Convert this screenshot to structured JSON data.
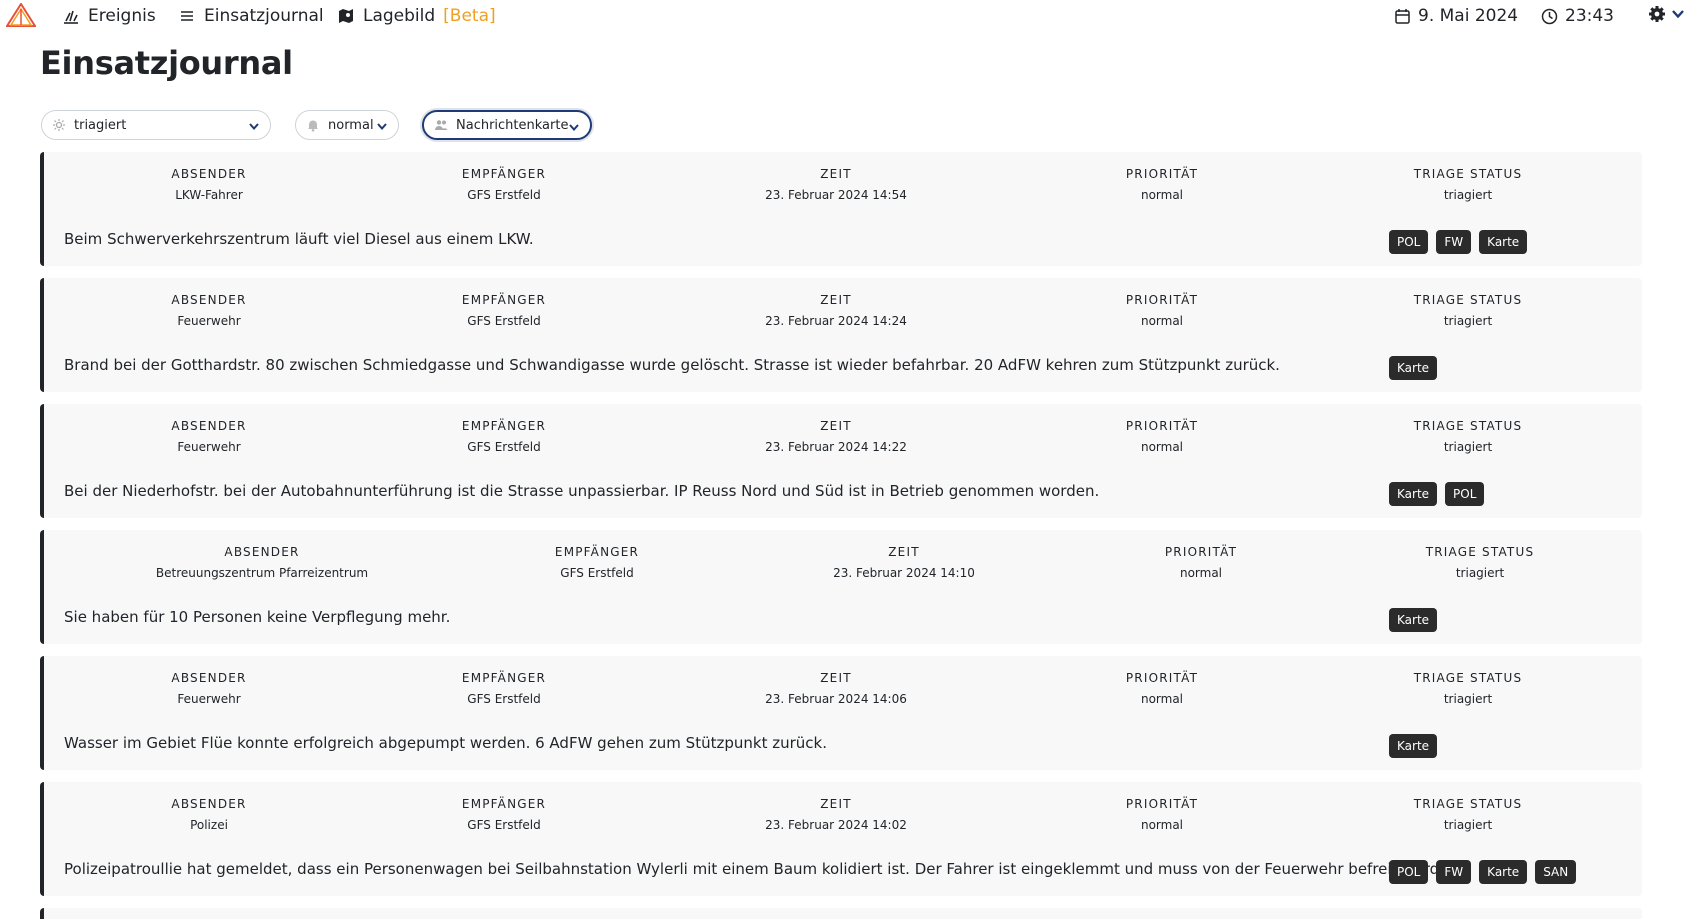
{
  "nav": {
    "items": [
      {
        "label": "Ereignis",
        "icon": "incident-icon"
      },
      {
        "label": "Einsatzjournal",
        "icon": "list-icon"
      },
      {
        "label": "Lagebild",
        "icon": "map-icon"
      }
    ],
    "beta_label": "[Beta]",
    "date": "9. Mai 2024",
    "time": "23:43"
  },
  "page": {
    "title": "Einsatzjournal"
  },
  "filters": [
    {
      "value": "triagiert",
      "icon": "triage-icon"
    },
    {
      "value": "normal",
      "icon": "bell-icon"
    },
    {
      "value": "Nachrichtenkarte",
      "icon": "people-icon"
    }
  ],
  "column_labels": [
    "ABSENDER",
    "EMPFÄNGER",
    "ZEIT",
    "PRIORITÄT",
    "TRIAGE STATUS"
  ],
  "messages": [
    {
      "sender": "LKW-Fahrer",
      "recipient": "GFS Erstfeld",
      "time": "23. Februar 2024 14:54",
      "priority": "normal",
      "status": "triagiert",
      "text": "Beim Schwerverkehrszentrum läuft viel Diesel aus einem LKW.",
      "tags": [
        "POL",
        "FW",
        "Karte"
      ]
    },
    {
      "sender": "Feuerwehr",
      "recipient": "GFS Erstfeld",
      "time": "23. Februar 2024 14:24",
      "priority": "normal",
      "status": "triagiert",
      "text": "Brand bei der Gotthardstr. 80 zwischen Schmiedgasse und Schwandigasse wurde gelöscht. Strasse ist wieder befahrbar. 20 AdFW kehren zum Stützpunkt zurück.",
      "tags": [
        "Karte"
      ]
    },
    {
      "sender": "Feuerwehr",
      "recipient": "GFS Erstfeld",
      "time": "23. Februar 2024 14:22",
      "priority": "normal",
      "status": "triagiert",
      "text": "Bei der Niederhofstr. bei der Autobahnunterführung ist die Strasse unpassierbar. IP Reuss Nord und Süd ist in Betrieb genommen worden.",
      "tags": [
        "Karte",
        "POL"
      ]
    },
    {
      "sender": "Betreuungszentrum Pfarreizentrum",
      "recipient": "GFS Erstfeld",
      "time": "23. Februar 2024 14:10",
      "priority": "normal",
      "status": "triagiert",
      "text": "Sie haben für 10 Personen keine Verpflegung mehr.",
      "tags": [
        "Karte"
      ]
    },
    {
      "sender": "Feuerwehr",
      "recipient": "GFS Erstfeld",
      "time": "23. Februar 2024 14:06",
      "priority": "normal",
      "status": "triagiert",
      "text": "Wasser im Gebiet Flüe konnte erfolgreich abgepumpt werden. 6 AdFW gehen zum Stützpunkt zurück.",
      "tags": [
        "Karte"
      ]
    },
    {
      "sender": "Polizei",
      "recipient": "GFS Erstfeld",
      "time": "23. Februar 2024 14:02",
      "priority": "normal",
      "status": "triagiert",
      "text": "Polizeipatroullie hat gemeldet, dass ein Personenwagen bei Seilbahnstation Wylerli mit einem Baum kolidiert ist. Der Fahrer ist eingeklemmt und muss von der Feuerwehr befreit werden.",
      "tags": [
        "POL",
        "FW",
        "Karte",
        "SAN"
      ]
    }
  ],
  "colors": {
    "accent": "#f0a020",
    "tag_bg": "#2b2b2b",
    "card_bg": "#f8f8f8",
    "focus": "#1f3a75"
  }
}
